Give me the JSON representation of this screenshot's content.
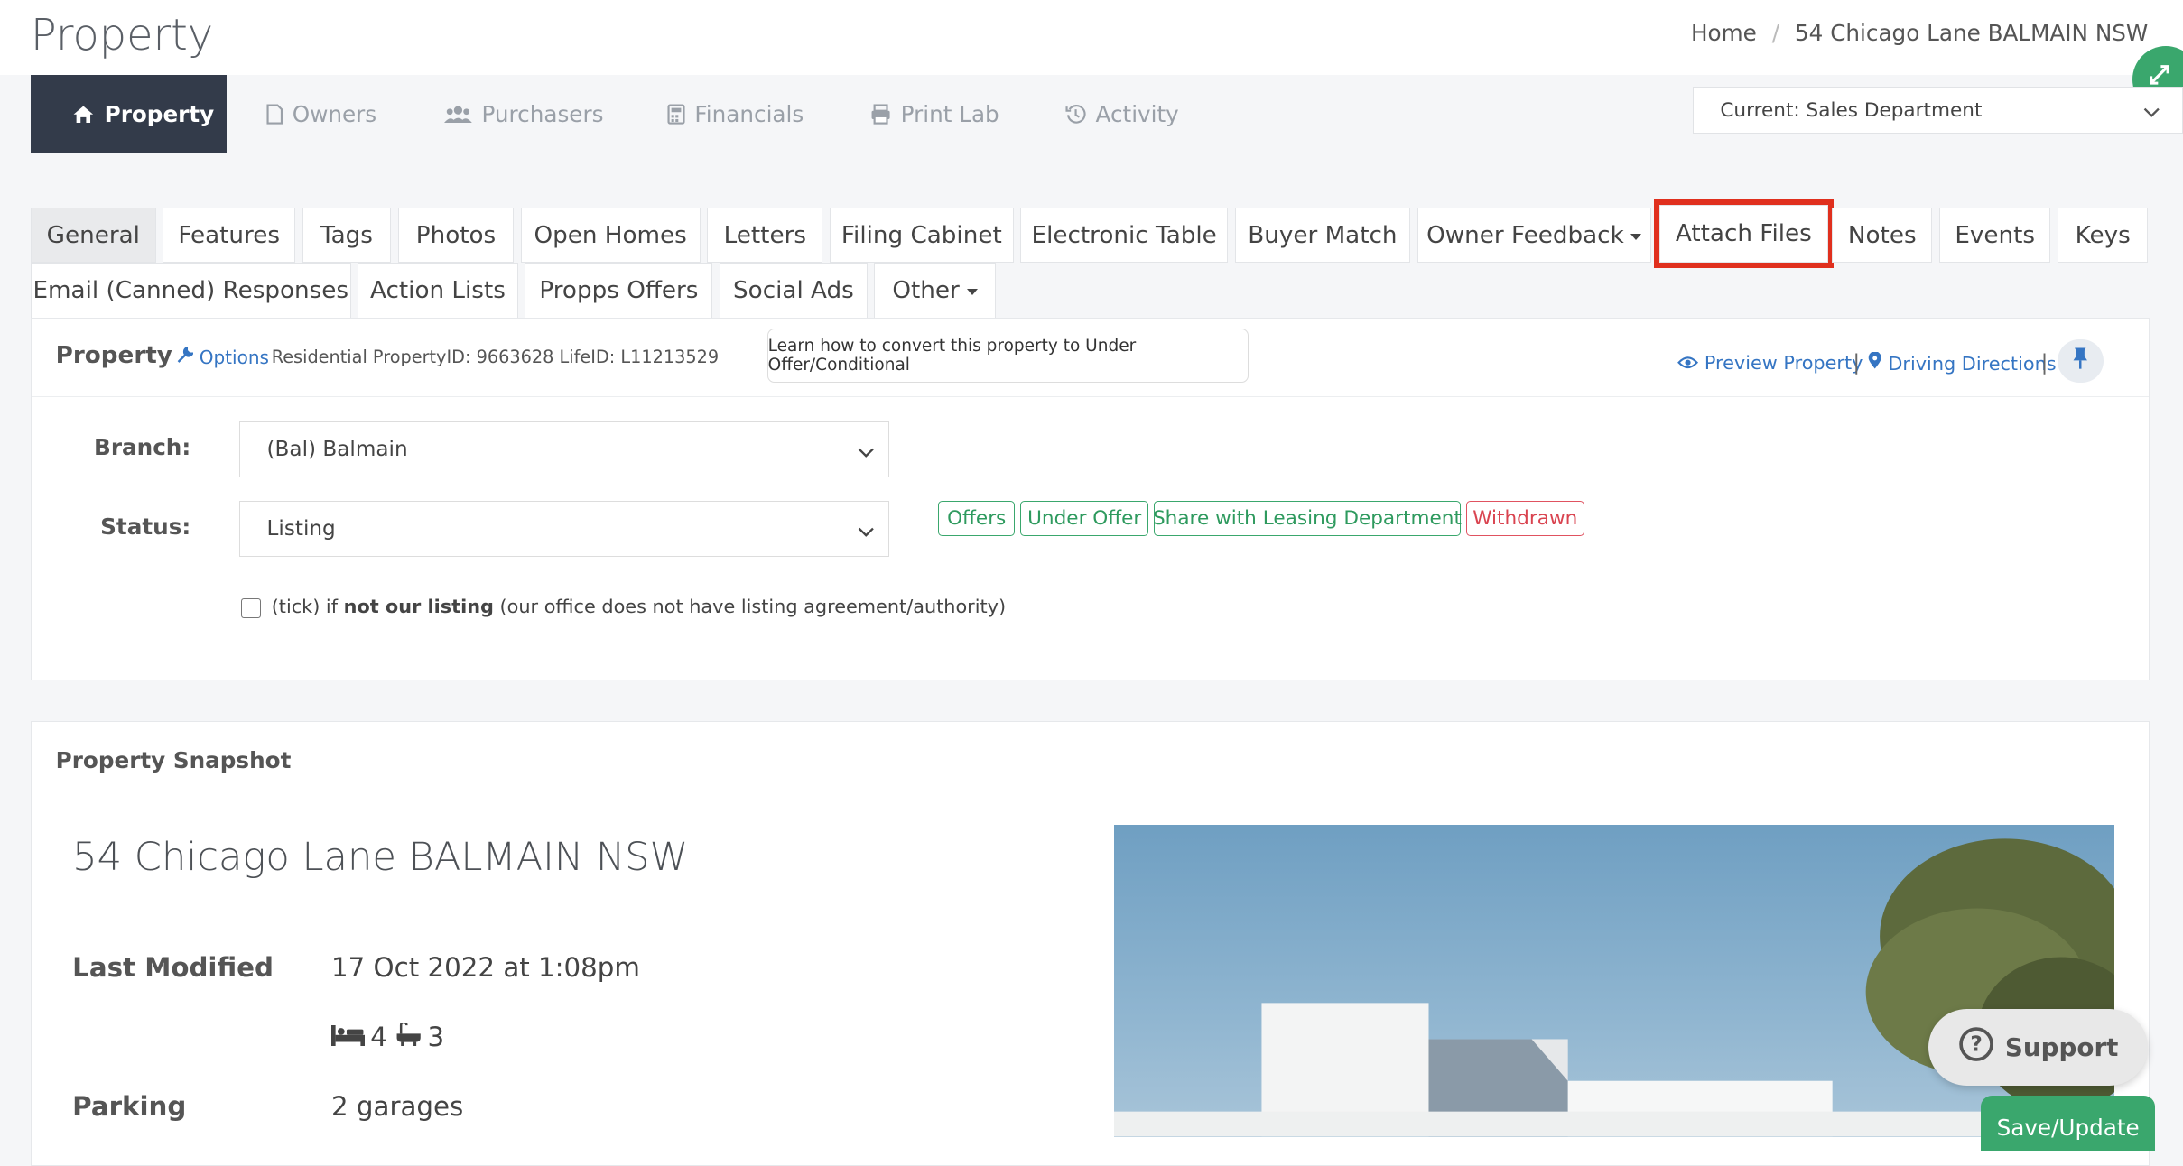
{
  "page": {
    "title": "Property"
  },
  "breadcrumb": {
    "home": "Home",
    "current": "54 Chicago Lane BALMAIN NSW"
  },
  "nav": {
    "tabs": [
      {
        "label": "Property",
        "icon": "home-icon"
      },
      {
        "label": "Owners",
        "icon": "file-icon"
      },
      {
        "label": "Purchasers",
        "icon": "users-icon"
      },
      {
        "label": "Financials",
        "icon": "calculator-icon"
      },
      {
        "label": "Print Lab",
        "icon": "printer-icon"
      },
      {
        "label": "Activity",
        "icon": "history-icon"
      }
    ],
    "department": "Current: Sales Department"
  },
  "subtabs": {
    "row1": [
      "General",
      "Features",
      "Tags",
      "Photos",
      "Open Homes",
      "Letters",
      "Filing Cabinet",
      "Electronic Table",
      "Buyer Match",
      "Owner Feedback",
      "Attach Files",
      "Notes",
      "Events",
      "Keys"
    ],
    "row2": [
      "Email (Canned) Responses",
      "Action Lists",
      "Propps Offers",
      "Social Ads",
      "Other"
    ]
  },
  "property_card": {
    "title": "Property",
    "options": "Options",
    "meta": "Residential PropertyID: 9663628",
    "life_id": "LifeID: L11213529",
    "tooltip": "Learn how to convert this property to Under Offer/Conditional",
    "preview": "Preview Property",
    "directions": "Driving Directions",
    "branch_label": "Branch:",
    "branch_value": "(Bal) Balmain",
    "status_label": "Status:",
    "status_value": "Listing",
    "status_buttons": [
      "Offers",
      "Under Offer",
      "Share with Leasing Department",
      "Withdrawn"
    ],
    "checkbox": {
      "prefix": "(tick) if ",
      "bold": "not our listing",
      "suffix": " (our office does not have listing agreement/authority)"
    }
  },
  "snapshot": {
    "header": "Property Snapshot",
    "address": "54 Chicago Lane BALMAIN NSW",
    "last_modified_label": "Last Modified",
    "last_modified_value": "17 Oct 2022 at 1:08pm",
    "beds": "4",
    "baths": "3",
    "parking_label": "Parking",
    "parking_value": "2 garages"
  },
  "actions": {
    "support": "Support",
    "save": "Save/Update"
  },
  "colors": {
    "nav_active": "#333b4a",
    "accent_green": "#3aa76d",
    "link_blue": "#3575c3",
    "highlight_red": "#e0301e",
    "danger": "#d9434f"
  }
}
